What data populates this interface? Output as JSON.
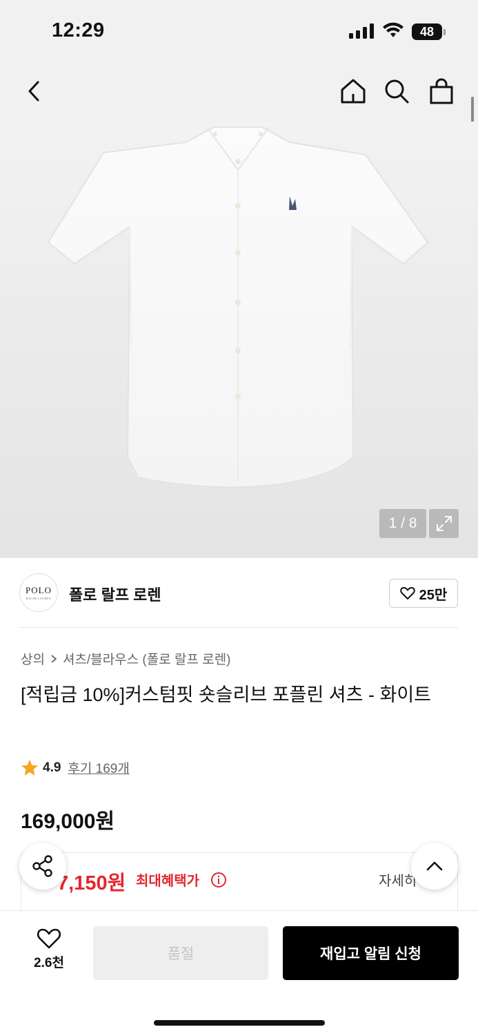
{
  "status_bar": {
    "time": "12:29",
    "battery": "48"
  },
  "nav": {
    "back_icon": "chevron-left-icon",
    "home_icon": "home-icon",
    "search_icon": "search-icon",
    "bag_icon": "shopping-bag-icon"
  },
  "gallery": {
    "counter": "1 / 8",
    "expand_icon": "expand-icon"
  },
  "brand": {
    "logo_text": "POLO",
    "logo_sub": "RALPH LAUREN",
    "name": "폴로 랄프 로렌",
    "likes": "25만"
  },
  "breadcrumb": {
    "level1": "상의",
    "level2": "셔츠/블라우스 (폴로 랄프 로렌)"
  },
  "product": {
    "title": "[적립금 10%]커스텀핏 숏슬리브 포플린 셔츠 - 화이트",
    "rating": "4.9",
    "review_link": "후기 169개",
    "price": "169,000원"
  },
  "benefit": {
    "price": "7,150원",
    "label": "최대혜택가",
    "detail": "자세히"
  },
  "bottom_bar": {
    "wish_count": "2.6천",
    "soldout_label": "품절",
    "restock_label": "재입고 알림 신청"
  },
  "colors": {
    "accent_red": "#e3262e",
    "star": "#f5a623",
    "cta": "#000000"
  }
}
